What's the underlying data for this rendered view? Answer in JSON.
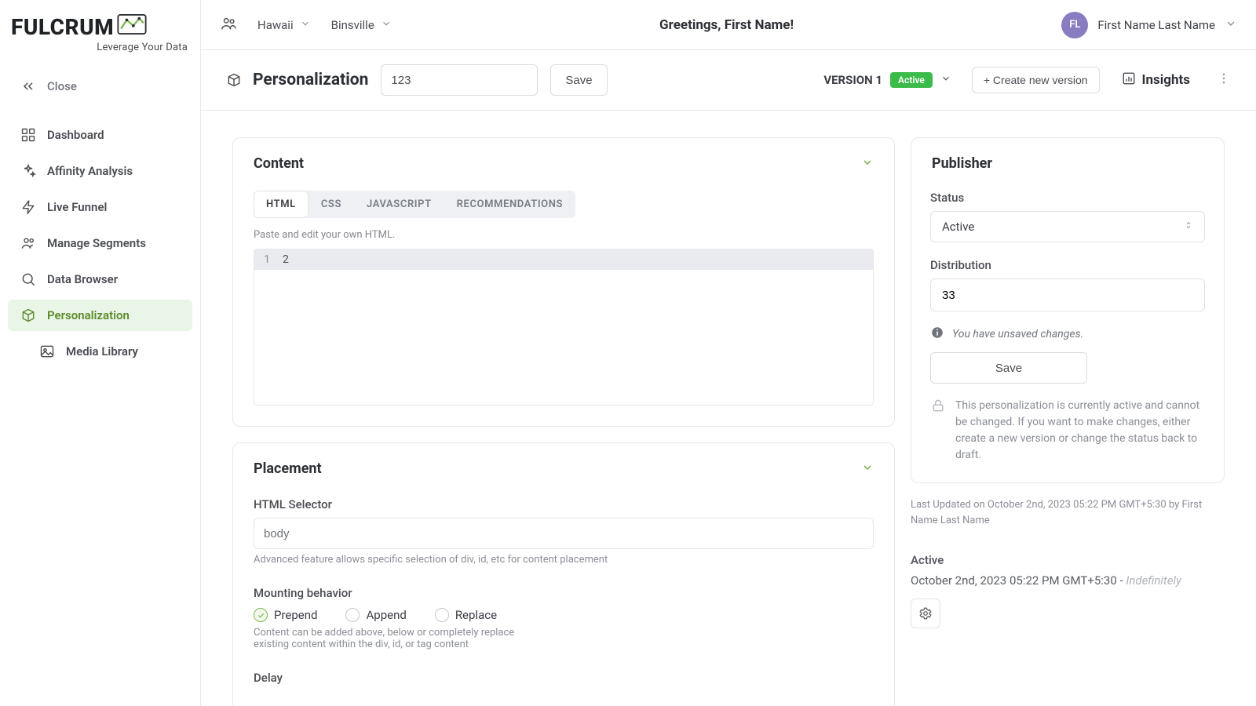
{
  "brand": {
    "name": "FULCRUM",
    "tagline": "Leverage Your Data"
  },
  "topbar": {
    "crumb1": "Hawaii",
    "crumb2": "Binsville",
    "greeting": "Greetings, First Name!",
    "avatar_initials": "FL",
    "user_name": "First Name Last Name"
  },
  "sidebar": {
    "close": "Close",
    "items": [
      {
        "label": "Dashboard"
      },
      {
        "label": "Affinity Analysis"
      },
      {
        "label": "Live Funnel"
      },
      {
        "label": "Manage Segments"
      },
      {
        "label": "Data Browser"
      },
      {
        "label": "Personalization"
      },
      {
        "label": "Media Library"
      }
    ]
  },
  "page": {
    "title": "Personalization",
    "name_value": "123",
    "save": "Save",
    "version": "VERSION 1",
    "status_badge": "Active",
    "create_version": "+ Create new version",
    "insights": "Insights"
  },
  "content_card": {
    "title": "Content",
    "tabs": {
      "html": "HTML",
      "css": "CSS",
      "js": "JAVASCRIPT",
      "rec": "RECOMMENDATIONS"
    },
    "hint": "Paste and edit your own HTML.",
    "line1": "1",
    "code1": "2"
  },
  "placement_card": {
    "title": "Placement",
    "selector_label": "HTML Selector",
    "selector_value": "body",
    "selector_help": "Advanced feature allows specific selection of div, id, etc for content placement",
    "mounting_label": "Mounting behavior",
    "opts": {
      "prepend": "Prepend",
      "append": "Append",
      "replace": "Replace"
    },
    "mounting_help": "Content can be added above, below or completely replace existing content within the div, id, or tag content",
    "delay_label": "Delay"
  },
  "publisher": {
    "title": "Publisher",
    "status_label": "Status",
    "status_value": "Active",
    "distribution_label": "Distribution",
    "distribution_value": "33",
    "unsaved": "You have unsaved changes.",
    "save": "Save",
    "lock_note": "This personalization is currently active and cannot be changed. If you want to make changes, either create a new version or change the status back to draft.",
    "last_updated": "Last Updated on October 2nd, 2023 05:22 PM GMT+5:30 by First Name Last Name",
    "state": "Active",
    "state_time": "October 2nd, 2023 05:22 PM GMT+5:30 - ",
    "state_time_suffix": "Indefinitely"
  }
}
